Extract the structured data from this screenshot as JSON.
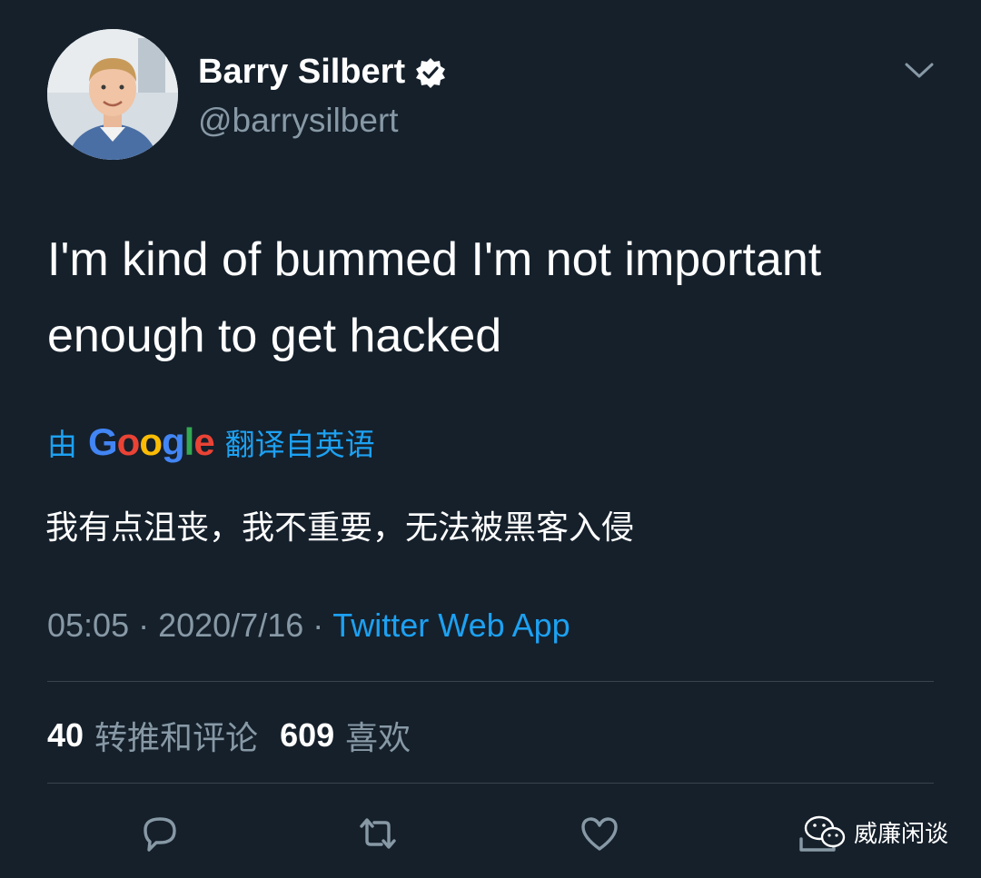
{
  "author": {
    "name": "Barry Silbert",
    "handle": "@barrysilbert",
    "verified": true
  },
  "tweet": {
    "text_line1": "I'm kind of bummed I'm not important",
    "text_line2": "enough to get hacked"
  },
  "translation": {
    "prefix": "由",
    "provider_letters": [
      "G",
      "o",
      "o",
      "g",
      "l",
      "e"
    ],
    "suffix": "翻译自英语",
    "text": "我有点沮丧，我不重要，无法被黑客入侵"
  },
  "meta": {
    "time": "05:05",
    "separator": "·",
    "date": "2020/7/16",
    "source": "Twitter Web App"
  },
  "stats": {
    "retweets_count": "40",
    "retweets_label": "转推和评论",
    "likes_count": "609",
    "likes_label": "喜欢"
  },
  "actions": [
    "reply-icon",
    "retweet-icon",
    "like-icon",
    "share-icon"
  ],
  "watermark": {
    "text": "威廉闲谈"
  },
  "colors": {
    "background": "#15202b",
    "accent": "#1da1f2",
    "muted": "#8899a6",
    "divider": "#38444d"
  }
}
